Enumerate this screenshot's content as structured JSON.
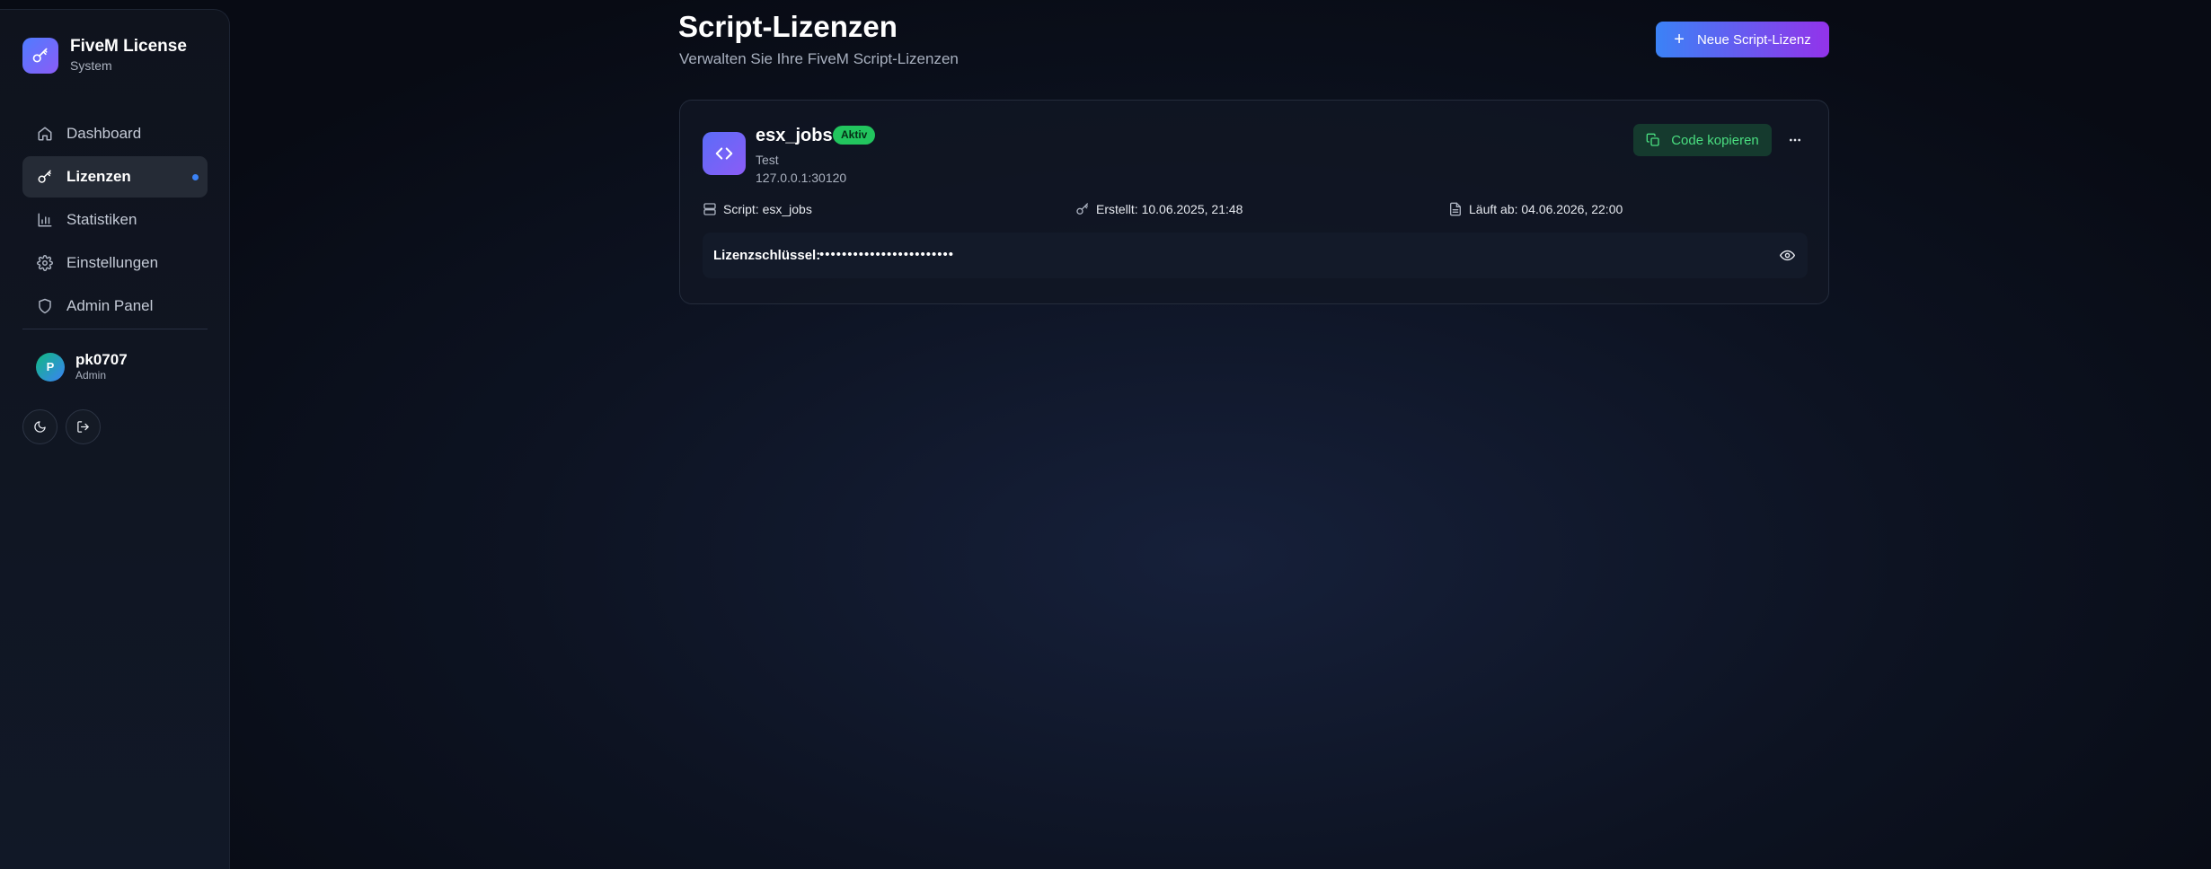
{
  "brand": {
    "title": "FiveM License",
    "subtitle": "System",
    "icon": "key-icon"
  },
  "sidebar": {
    "items": [
      {
        "label": "Dashboard",
        "icon": "home-icon",
        "active": false
      },
      {
        "label": "Lizenzen",
        "icon": "key-icon",
        "active": true
      },
      {
        "label": "Statistiken",
        "icon": "bar-chart-icon",
        "active": false
      },
      {
        "label": "Einstellungen",
        "icon": "gear-icon",
        "active": false
      },
      {
        "label": "Admin Panel",
        "icon": "shield-icon",
        "active": false
      }
    ]
  },
  "user": {
    "initial": "P",
    "name": "pk0707",
    "role": "Admin"
  },
  "page": {
    "title": "Script-Lizenzen",
    "subtitle": "Verwalten Sie Ihre FiveM Script-Lizenzen",
    "new_button": "Neue Script-Lizenz"
  },
  "license": {
    "name": "esx_jobs",
    "status": "Aktiv",
    "description": "Test",
    "ip": "127.0.0.1:30120",
    "copy_button": "Code kopieren",
    "script": "Script: esx_jobs",
    "created": "Erstellt: 10.06.2025, 21:48",
    "expires": "Läuft ab: 04.06.2026, 22:00",
    "key_label": "Lizenzschlüssel:",
    "key_value": "••••••••••••••••••••••••"
  },
  "colors": {
    "accent_start": "#3b82f6",
    "accent_end": "#9333ea",
    "active_badge": "#22c55e",
    "copy_text": "#4ade80"
  }
}
